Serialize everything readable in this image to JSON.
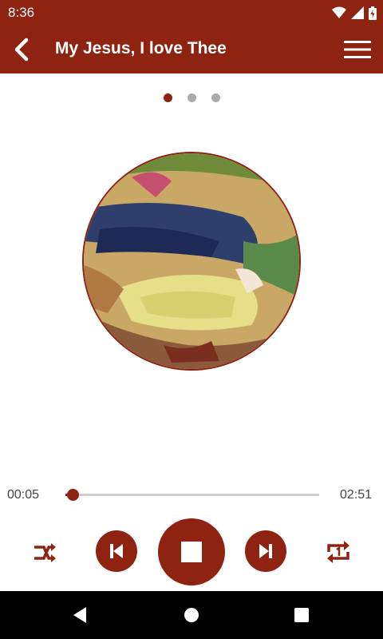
{
  "status_bar": {
    "time": "8:36",
    "icons": [
      "wifi-icon",
      "signal-icon",
      "battery-icon"
    ]
  },
  "app_bar": {
    "title": "My Jesus, I love Thee",
    "back_icon": "back-chevron-icon",
    "menu_icon": "hamburger-menu-icon"
  },
  "pager": {
    "count": 3,
    "active_index": 0
  },
  "player": {
    "elapsed": "00:05",
    "duration": "02:51",
    "progress": 0.029,
    "controls": [
      "shuffle-icon",
      "skip-previous-icon",
      "stop-icon",
      "skip-next-icon",
      "repeat-one-icon"
    ]
  },
  "colors": {
    "accent": "#8f2312",
    "inactive_dot": "#aaaaaa",
    "nav_bar": "#000000"
  }
}
